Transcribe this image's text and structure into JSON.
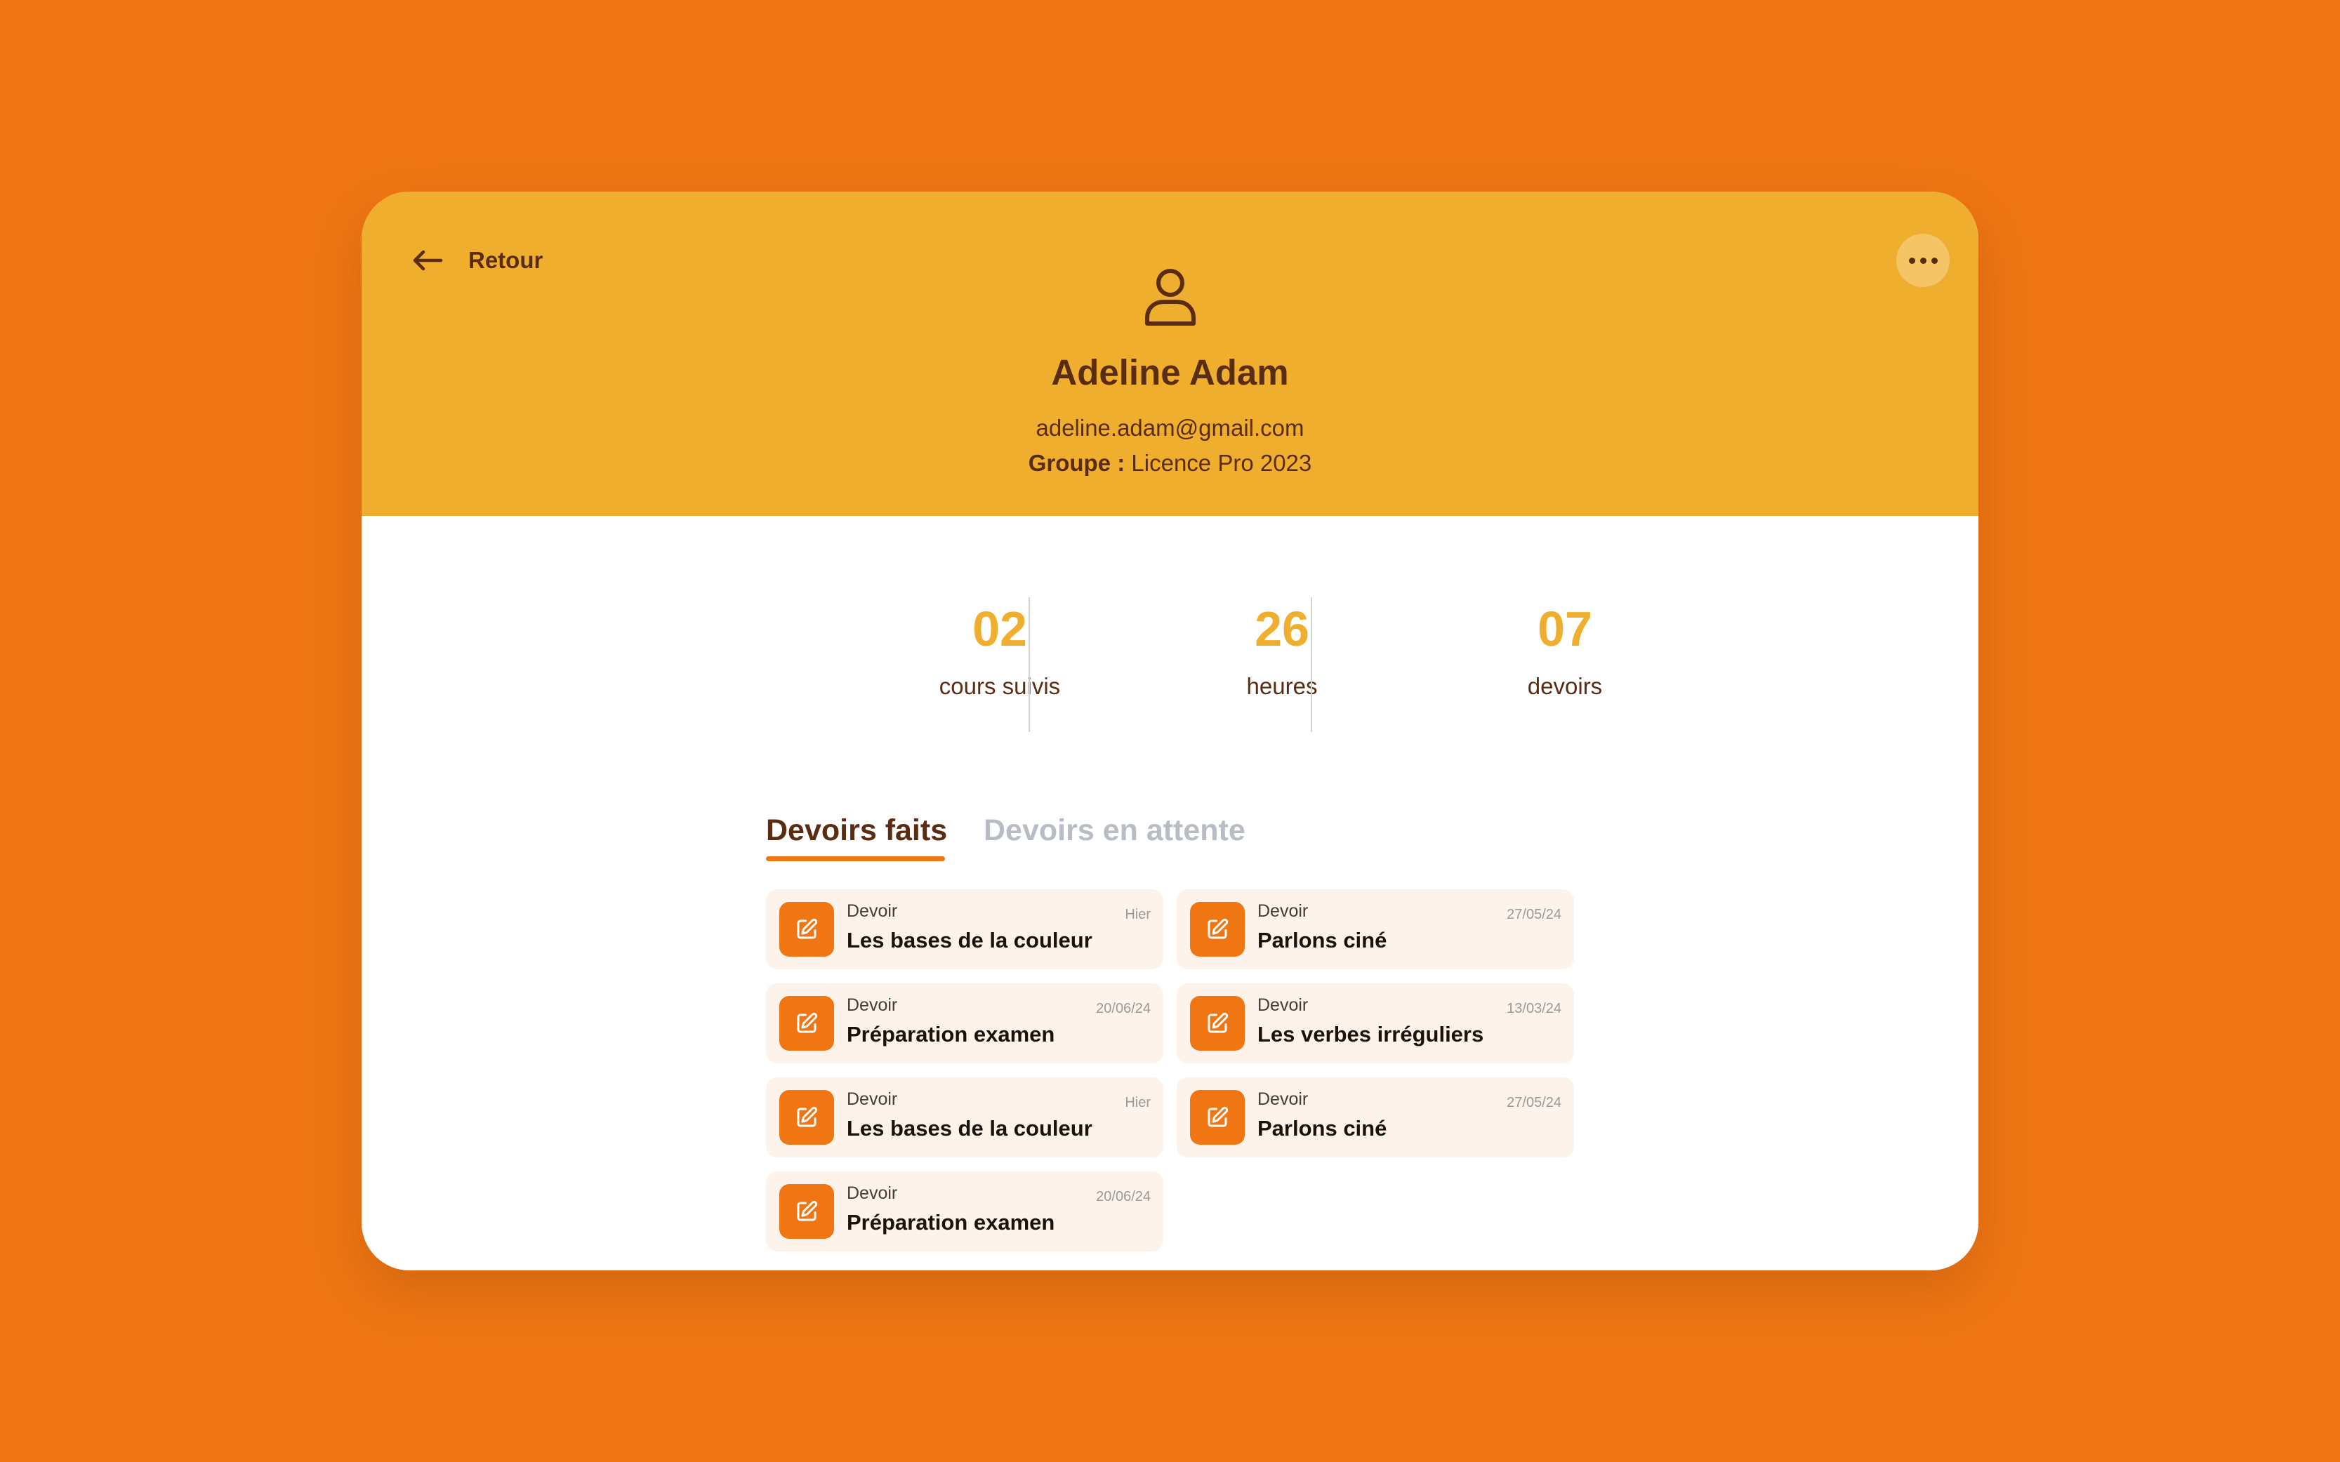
{
  "header": {
    "back_label": "Retour",
    "name": "Adeline Adam",
    "email": "adeline.adam@gmail.com",
    "group_label": "Groupe :",
    "group_value": "Licence Pro 2023"
  },
  "stats": [
    {
      "value": "02",
      "label": "cours suivis"
    },
    {
      "value": "26",
      "label": "heures"
    },
    {
      "value": "07",
      "label": "devoirs"
    }
  ],
  "tabs": [
    {
      "label": "Devoirs faits",
      "active": true
    },
    {
      "label": "Devoirs en attente",
      "active": false
    }
  ],
  "items": [
    {
      "type": "Devoir",
      "title": "Les bases de la couleur",
      "date": "Hier"
    },
    {
      "type": "Devoir",
      "title": "Parlons ciné",
      "date": "27/05/24"
    },
    {
      "type": "Devoir",
      "title": "Préparation examen",
      "date": "20/06/24"
    },
    {
      "type": "Devoir",
      "title": "Les verbes irréguliers",
      "date": "13/03/24"
    },
    {
      "type": "Devoir",
      "title": "Les bases de la couleur",
      "date": "Hier"
    },
    {
      "type": "Devoir",
      "title": "Parlons ciné",
      "date": "27/05/24"
    },
    {
      "type": "Devoir",
      "title": "Préparation examen",
      "date": "20/06/24"
    }
  ],
  "icons": {
    "back": "arrow-left-icon",
    "more": "more-dots-icon",
    "avatar": "user-icon",
    "item": "edit-icon"
  },
  "colors": {
    "background": "#EF7613",
    "header": "#F0AE2E",
    "text_dark": "#5A2D12",
    "accent": "#EF7613",
    "item_bg": "#FDF3EA"
  }
}
